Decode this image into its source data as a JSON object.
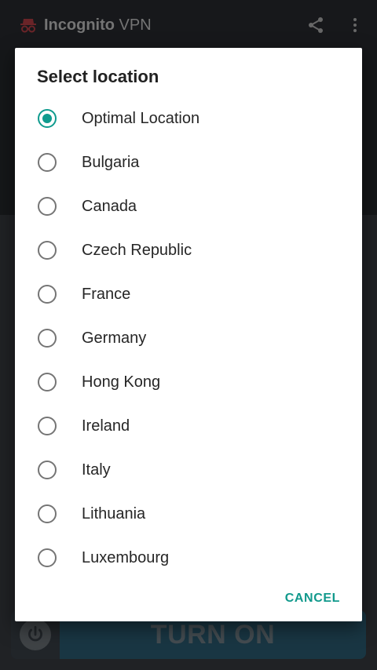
{
  "app": {
    "title_bold": "Incognito",
    "title_light": "VPN",
    "logo_icon": "incognito-icon",
    "share_icon": "share-icon",
    "menu_icon": "more-vert-icon",
    "turn_on_label": "TURN ON",
    "power_icon": "power-icon"
  },
  "dialog": {
    "title": "Select location",
    "options": [
      {
        "label": "Optimal Location",
        "selected": true
      },
      {
        "label": "Bulgaria",
        "selected": false
      },
      {
        "label": "Canada",
        "selected": false
      },
      {
        "label": "Czech Republic",
        "selected": false
      },
      {
        "label": "France",
        "selected": false
      },
      {
        "label": "Germany",
        "selected": false
      },
      {
        "label": "Hong Kong",
        "selected": false
      },
      {
        "label": "Ireland",
        "selected": false
      },
      {
        "label": "Italy",
        "selected": false
      },
      {
        "label": "Lithuania",
        "selected": false
      },
      {
        "label": "Luxembourg",
        "selected": false
      }
    ],
    "cancel_label": "CANCEL"
  },
  "colors": {
    "accent": "#0f9b8e",
    "logo": "#a2343a"
  }
}
